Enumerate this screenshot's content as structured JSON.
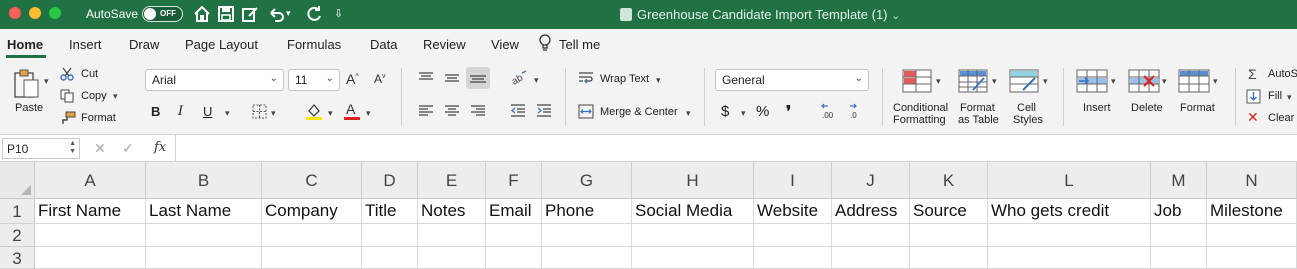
{
  "titlebar": {
    "autosave_label": "AutoSave",
    "toggle_state": "OFF",
    "document_title": "Greenhouse Candidate Import Template (1)",
    "title_chevron": "⌄"
  },
  "tabs": [
    "Home",
    "Insert",
    "Draw",
    "Page Layout",
    "Formulas",
    "Data",
    "Review",
    "View",
    "Tell me"
  ],
  "ribbon": {
    "paste": "Paste",
    "cut": "Cut",
    "copy": "Copy",
    "format_painter": "Format",
    "font_name": "Arial",
    "font_size": "11",
    "wrap_text": "Wrap Text",
    "merge_center": "Merge & Center",
    "number_format": "General",
    "conditional_formatting": [
      "Conditional",
      "Formatting"
    ],
    "format_as_table": [
      "Format",
      "as Table"
    ],
    "cell_styles": [
      "Cell",
      "Styles"
    ],
    "insert": "Insert",
    "delete": "Delete",
    "format": "Format",
    "autosum": "AutoS",
    "fill": "Fill",
    "clear": "Clear",
    "bold": "B",
    "italic": "I",
    "underline": "U",
    "currency": "$",
    "percent": "%",
    "comma": "❜",
    "increase_font": "A",
    "decrease_font": "A"
  },
  "formula_bar": {
    "name_box": "P10",
    "cancel": "✕",
    "enter": "✓",
    "fx": "fx",
    "formula": ""
  },
  "sheet": {
    "columns": [
      "A",
      "B",
      "C",
      "D",
      "E",
      "F",
      "G",
      "H",
      "I",
      "J",
      "K",
      "L",
      "M",
      "N"
    ],
    "rows": [
      "1",
      "2",
      "3"
    ],
    "row1": [
      "First Name",
      "Last Name",
      "Company",
      "Title",
      "Notes",
      "Email",
      "Phone",
      "Social Media",
      "Website",
      "Address",
      "Source",
      "Who gets credit",
      "Job",
      "Milestone"
    ]
  },
  "colors": {
    "accent": "#207245",
    "ribbon_bg": "#f3f3f3",
    "header_bg": "#ededed"
  }
}
